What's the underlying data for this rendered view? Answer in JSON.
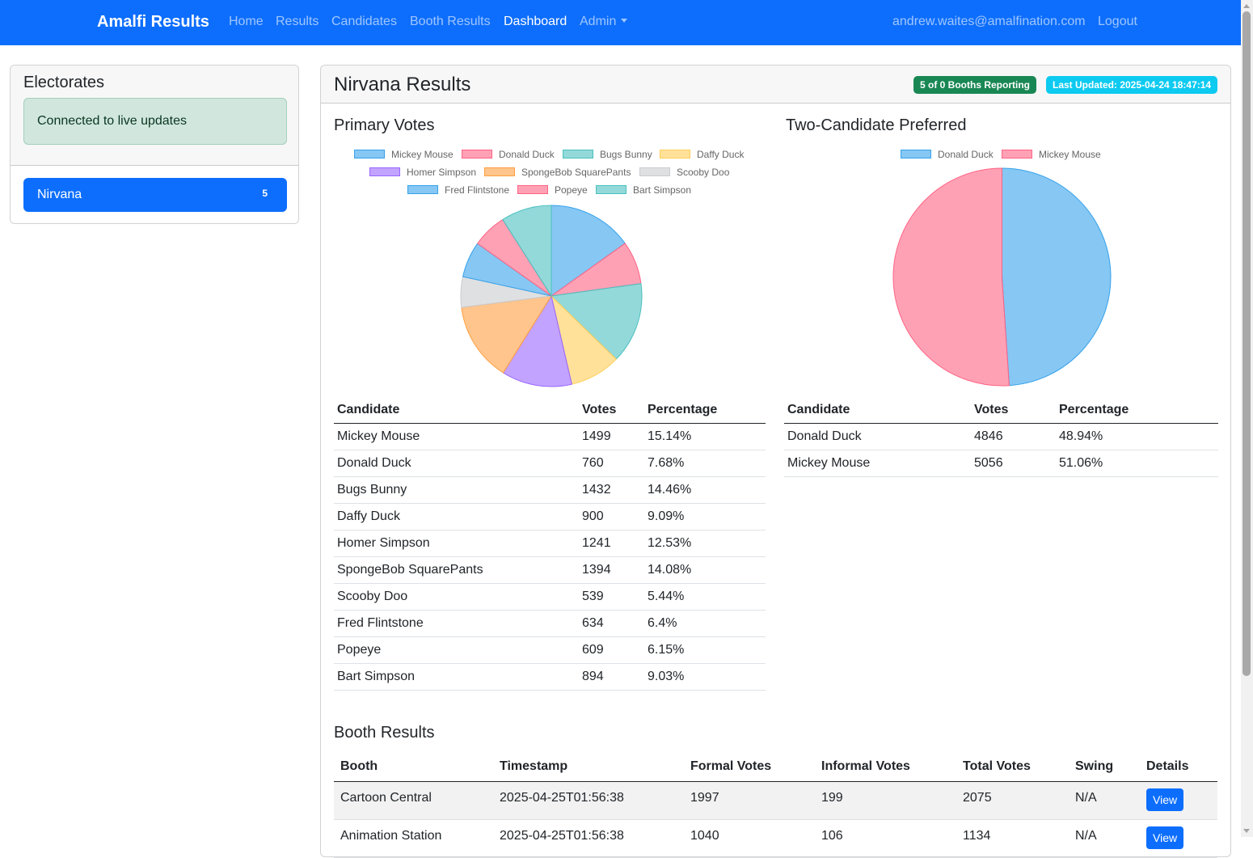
{
  "nav": {
    "brand": "Amalfi Results",
    "links": [
      "Home",
      "Results",
      "Candidates",
      "Booth Results",
      "Dashboard",
      "Admin"
    ],
    "user_email": "andrew.waites@amalfination.com",
    "logout": "Logout"
  },
  "sidebar": {
    "title": "Electorates",
    "status": "Connected to live updates",
    "items": [
      {
        "label": "Nirvana",
        "badge": "5"
      }
    ]
  },
  "main": {
    "title": "Nirvana Results",
    "booths_badge": "5 of 0 Booths Reporting",
    "updated_badge": "Last Updated: 2025-04-24 18:47:14",
    "primary_title": "Primary Votes",
    "tcp_title": "Two-Candidate Preferred",
    "table_headers": [
      "Candidate",
      "Votes",
      "Percentage"
    ],
    "primary_rows": [
      [
        "Mickey Mouse",
        "1499",
        "15.14%"
      ],
      [
        "Donald Duck",
        "760",
        "7.68%"
      ],
      [
        "Bugs Bunny",
        "1432",
        "14.46%"
      ],
      [
        "Daffy Duck",
        "900",
        "9.09%"
      ],
      [
        "Homer Simpson",
        "1241",
        "12.53%"
      ],
      [
        "SpongeBob SquarePants",
        "1394",
        "14.08%"
      ],
      [
        "Scooby Doo",
        "539",
        "5.44%"
      ],
      [
        "Fred Flintstone",
        "634",
        "6.4%"
      ],
      [
        "Popeye",
        "609",
        "6.15%"
      ],
      [
        "Bart Simpson",
        "894",
        "9.03%"
      ]
    ],
    "tcp_rows": [
      [
        "Donald Duck",
        "4846",
        "48.94%"
      ],
      [
        "Mickey Mouse",
        "5056",
        "51.06%"
      ]
    ],
    "booth_title": "Booth Results",
    "booth_headers": [
      "Booth",
      "Timestamp",
      "Formal Votes",
      "Informal Votes",
      "Total Votes",
      "Swing",
      "Details"
    ],
    "booth_rows": [
      [
        "Cartoon Central",
        "2025-04-25T01:56:38",
        "1997",
        "199",
        "2075",
        "N/A",
        "View"
      ],
      [
        "Animation Station",
        "2025-04-25T01:56:38",
        "1040",
        "106",
        "1134",
        "N/A",
        "View"
      ]
    ]
  },
  "chart_data": [
    {
      "type": "pie",
      "title": "Primary Votes",
      "categories": [
        "Mickey Mouse",
        "Donald Duck",
        "Bugs Bunny",
        "Daffy Duck",
        "Homer Simpson",
        "SpongeBob SquarePants",
        "Scooby Doo",
        "Fred Flintstone",
        "Popeye",
        "Bart Simpson"
      ],
      "values": [
        1499,
        760,
        1432,
        900,
        1241,
        1394,
        539,
        634,
        609,
        894
      ],
      "colors": [
        "#36a2eb",
        "#ff6384",
        "#4bc0c0",
        "#ffcd56",
        "#9966ff",
        "#ff9f40",
        "#c9cbcf",
        "#36a2eb",
        "#ff6384",
        "#4bc0c0"
      ],
      "legend": "top"
    },
    {
      "type": "pie",
      "title": "Two-Candidate Preferred",
      "categories": [
        "Donald Duck",
        "Mickey Mouse"
      ],
      "values": [
        4846,
        5056
      ],
      "colors": [
        "#36a2eb",
        "#ff6384"
      ],
      "legend": "top"
    }
  ]
}
